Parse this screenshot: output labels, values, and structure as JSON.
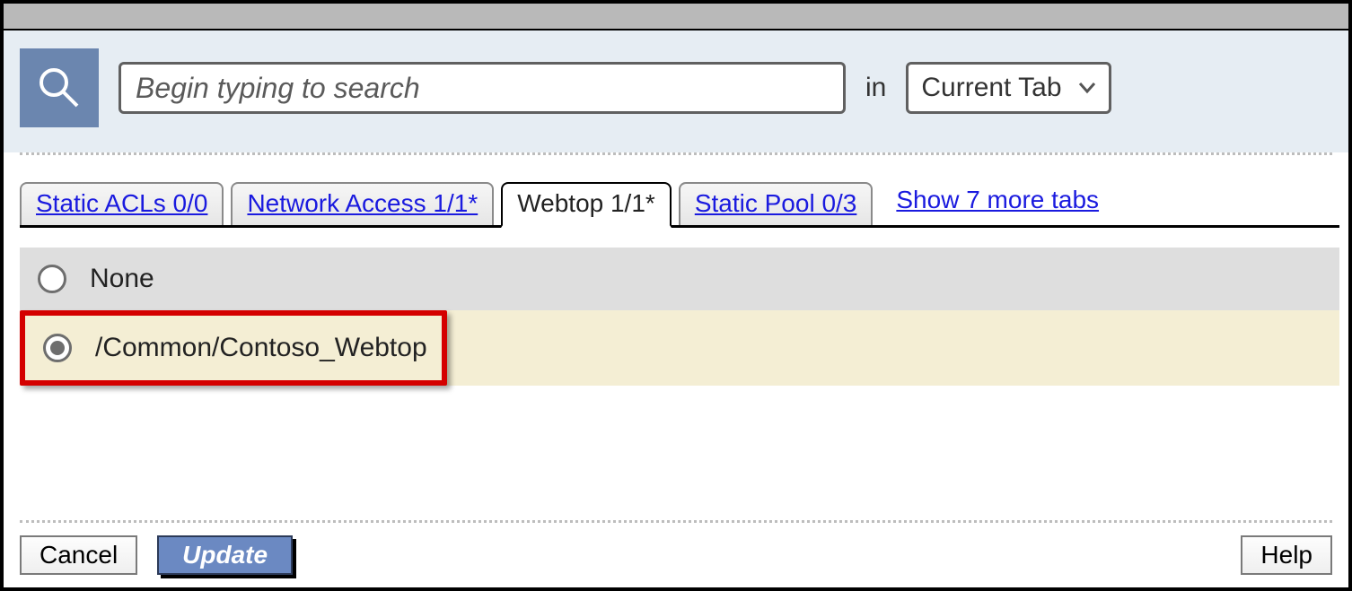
{
  "search": {
    "placeholder": "Begin typing to search",
    "in_label": "in",
    "scope": "Current Tab"
  },
  "tabs": [
    {
      "label": "Static ACLs 0/0",
      "active": false
    },
    {
      "label": "Network Access 1/1*",
      "active": false
    },
    {
      "label": "Webtop 1/1*",
      "active": true
    },
    {
      "label": "Static Pool 0/3",
      "active": false
    }
  ],
  "more_tabs": "Show 7 more tabs",
  "options": [
    {
      "label": "None",
      "selected": false
    },
    {
      "label": "/Common/Contoso_Webtop",
      "selected": true,
      "highlighted": true
    }
  ],
  "buttons": {
    "cancel": "Cancel",
    "update": "Update",
    "help": "Help"
  }
}
